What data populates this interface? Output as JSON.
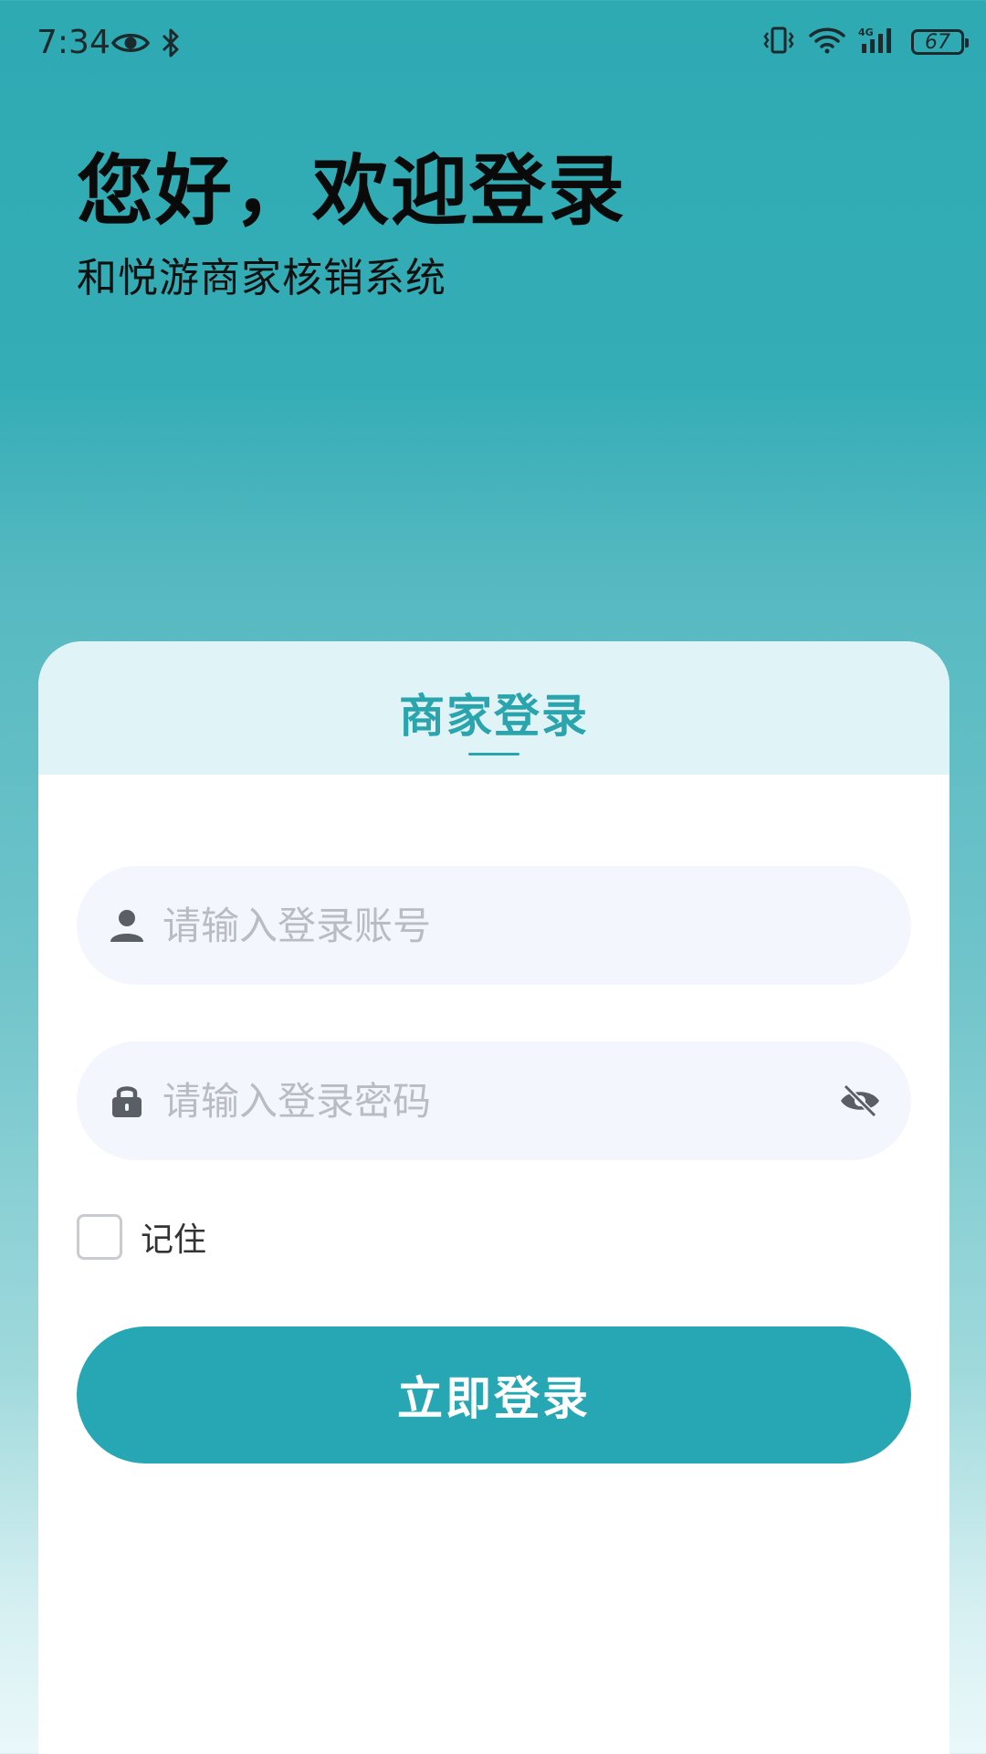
{
  "status_bar": {
    "time": "7:34",
    "battery_level": "67",
    "left_icons": [
      "eye-icon",
      "bluetooth-icon"
    ],
    "right_icons": [
      "vibrate-icon",
      "wifi-icon",
      "signal-4g-icon",
      "battery-icon"
    ]
  },
  "header": {
    "title": "您好，欢迎登录",
    "subtitle": "和悦游商家核销系统"
  },
  "card": {
    "title": "商家登录",
    "account": {
      "placeholder": "请输入登录账号",
      "value": "",
      "icon": "user-icon"
    },
    "password": {
      "placeholder": "请输入登录密码",
      "value": "",
      "icon": "lock-icon",
      "toggle_icon": "eye-off-icon"
    },
    "remember": {
      "label": "记住",
      "checked": false
    },
    "login_button_label": "立即登录"
  },
  "colors": {
    "accent": "#26a7b3",
    "card_header_bg": "#e0f3f7",
    "input_bg": "#f3f7fd",
    "placeholder": "#b8bcc4"
  }
}
